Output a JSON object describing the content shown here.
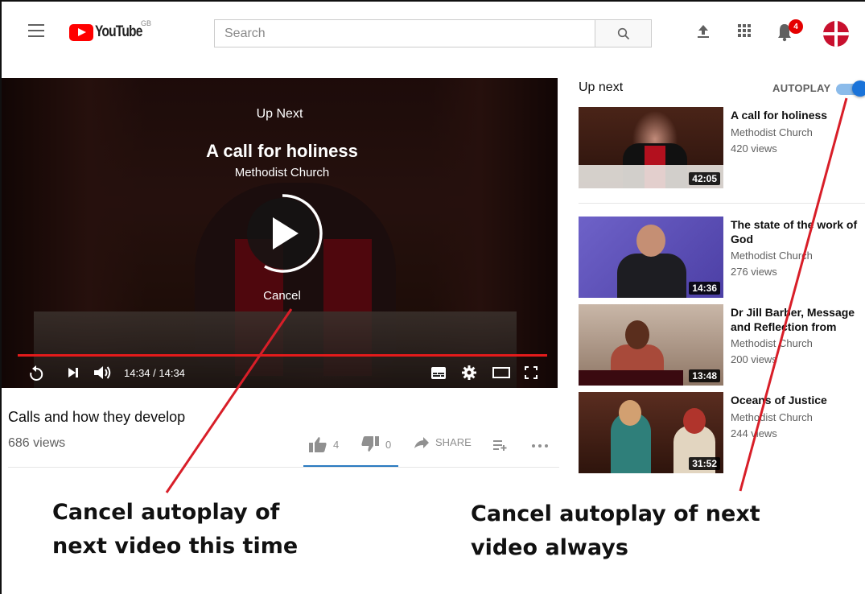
{
  "header": {
    "logo_text": "YouTube",
    "region": "GB",
    "search_placeholder": "Search",
    "notifications_count": "4",
    "icons": [
      "menu-icon",
      "search-icon",
      "upload-icon",
      "apps-icon",
      "bell-icon"
    ]
  },
  "player": {
    "up_next_label": "Up Next",
    "up_next_title": "A call for holiness",
    "up_next_channel": "Methodist Church",
    "cancel_label": "Cancel",
    "time": "14:34 / 14:34",
    "progress_fraction": 1.0,
    "accent_color": "#e31b1b"
  },
  "video": {
    "title": "Calls and how they develop",
    "views": "686 views",
    "likes": "4",
    "dislikes": "0",
    "share_label": "SHARE"
  },
  "sidebar": {
    "heading": "Up next",
    "autoplay_label": "AUTOPLAY",
    "autoplay_on": true,
    "items": [
      {
        "title": "A call for holiness",
        "channel": "Methodist Church",
        "views": "420 views",
        "duration": "42:05"
      },
      {
        "title": "The state of the work of God",
        "channel": "Methodist Church",
        "views": "276 views",
        "duration": "14:36"
      },
      {
        "title": "Dr Jill Barber, Message and Reflection from",
        "channel": "Methodist Church",
        "views": "200 views",
        "duration": "13:48"
      },
      {
        "title": "Oceans of Justice",
        "channel": "Methodist Church",
        "views": "244 views",
        "duration": "31:52"
      }
    ]
  },
  "annotations": {
    "left_line1": "Cancel autoplay of",
    "left_line2": "next video this time",
    "right_line1": "Cancel autoplay of next",
    "right_line2": "video always",
    "arrow_color": "#d81e28"
  }
}
